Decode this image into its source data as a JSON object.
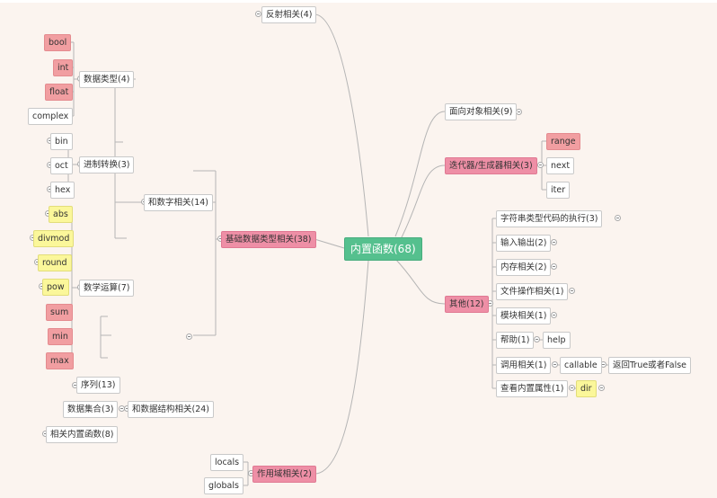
{
  "root": "内置函数(68)",
  "right": {
    "reflection": "反射相关(4)",
    "oop": "面向对象相关(9)",
    "iter": "迭代器/生成器相关(3)",
    "iter_items": [
      "range",
      "next",
      "iter"
    ],
    "other": "其他(12)",
    "other_items": [
      "字符串类型代码的执行(3)",
      "输入输出(2)",
      "内存相关(2)",
      "文件操作相关(1)",
      "模块相关(1)",
      "帮助(1)",
      "调用相关(1)",
      "查看内置属性(1)"
    ],
    "help_leaf": "help",
    "callable_leaf": "callable",
    "callable_note": "返回True或者False",
    "dir_leaf": "dir",
    "scope": "作用域相关(2)",
    "scope_items": [
      "locals",
      "globals"
    ]
  },
  "left": {
    "basic": "基础数据类型相关(38)",
    "number": "和数字相关(14)",
    "datatype": "数据类型(4)",
    "datatype_items": [
      "bool",
      "int",
      "float",
      "complex"
    ],
    "convert": "进制转换(3)",
    "convert_items": [
      "bin",
      "oct",
      "hex"
    ],
    "math": "数学运算(7)",
    "math_items": [
      "abs",
      "divmod",
      "round",
      "pow",
      "sum",
      "min",
      "max"
    ],
    "datastruct": "和数据结构相关(24)",
    "sequence": "序列(13)",
    "collection": "数据集合(3)",
    "related": "相关内置函数(8)"
  }
}
